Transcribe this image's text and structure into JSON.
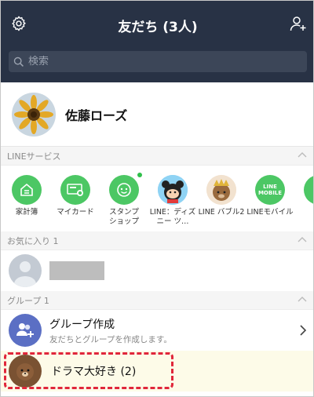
{
  "header": {
    "title": "友だち (3人)",
    "settings_icon": "gear-icon",
    "add_friend_icon": "add-friend-icon"
  },
  "search": {
    "placeholder": "検索"
  },
  "profile": {
    "name": "佐藤ローズ"
  },
  "sections": {
    "services": "LINEサービス",
    "favorites": "お気に入り 1",
    "groups": "グループ 1"
  },
  "services": [
    {
      "label": "家計簿",
      "icon": "household-ledger-icon"
    },
    {
      "label": "マイカード",
      "icon": "mycard-icon"
    },
    {
      "label": "スタンプ\nショップ",
      "icon": "sticker-shop-icon"
    },
    {
      "label": "LINE：ディズニー ツ…",
      "icon": "disney-tsumtsum-icon"
    },
    {
      "label": "LINE バブル2",
      "icon": "line-bubble2-icon"
    },
    {
      "label": "LINEモバイル",
      "icon": "line-mobile-icon",
      "icon_text": "LINE MOBILE"
    },
    {
      "label": "",
      "icon": "more-service-icon"
    }
  ],
  "group_create": {
    "title": "グループ作成",
    "subtitle": "友だちとグループを作成します。"
  },
  "group": {
    "name": "ドラマ大好き (2)"
  },
  "colors": {
    "header_bg": "#283245",
    "line_green": "#4cc764",
    "highlight": "#e0263a",
    "group_row_bg": "#fdfbe8"
  }
}
